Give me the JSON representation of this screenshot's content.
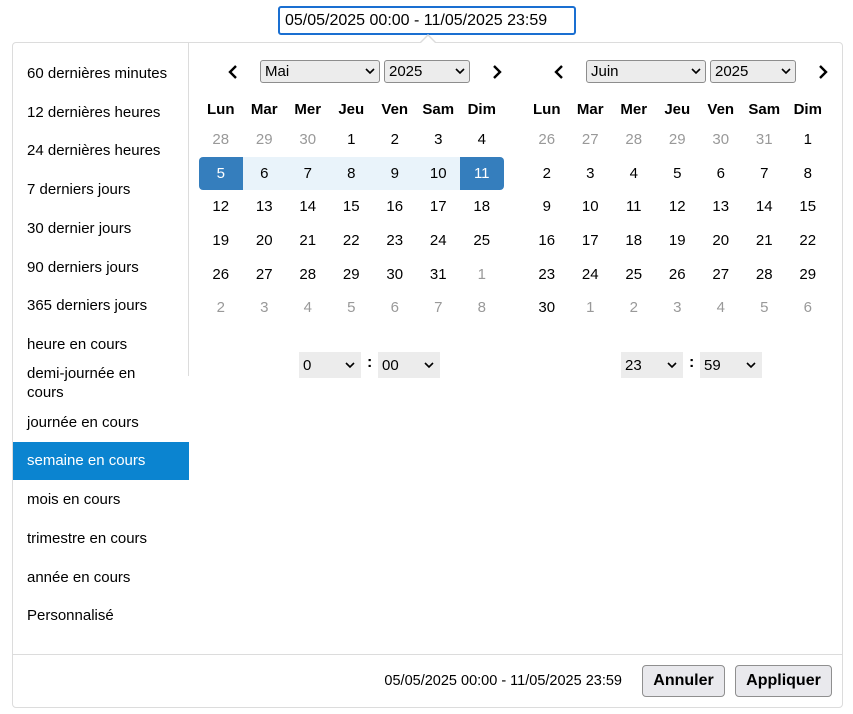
{
  "input": {
    "value": "05/05/2025 00:00 - 11/05/2025 23:59"
  },
  "ranges": [
    "60 dernières minutes",
    "12 dernières heures",
    "24 dernières heures",
    "7 derniers jours",
    "30 dernier jours",
    "90 derniers jours",
    "365 derniers jours",
    "heure en cours",
    "demi-journée en cours",
    "journée en cours",
    "semaine en cours",
    "mois en cours",
    "trimestre en cours",
    "année en cours",
    "Personnalisé"
  ],
  "active_range_index": 10,
  "weekdays": [
    "Lun",
    "Mar",
    "Mer",
    "Jeu",
    "Ven",
    "Sam",
    "Dim"
  ],
  "left_calendar": {
    "month": "Mai",
    "year": "2025",
    "weeks": [
      [
        {
          "d": "28",
          "s": "off"
        },
        {
          "d": "29",
          "s": "off"
        },
        {
          "d": "30",
          "s": "off"
        },
        {
          "d": "1",
          "s": ""
        },
        {
          "d": "2",
          "s": ""
        },
        {
          "d": "3",
          "s": ""
        },
        {
          "d": "4",
          "s": ""
        }
      ],
      [
        {
          "d": "5",
          "s": "start"
        },
        {
          "d": "6",
          "s": "inrange"
        },
        {
          "d": "7",
          "s": "inrange"
        },
        {
          "d": "8",
          "s": "inrange"
        },
        {
          "d": "9",
          "s": "inrange"
        },
        {
          "d": "10",
          "s": "inrange"
        },
        {
          "d": "11",
          "s": "end"
        }
      ],
      [
        {
          "d": "12",
          "s": ""
        },
        {
          "d": "13",
          "s": ""
        },
        {
          "d": "14",
          "s": ""
        },
        {
          "d": "15",
          "s": ""
        },
        {
          "d": "16",
          "s": ""
        },
        {
          "d": "17",
          "s": ""
        },
        {
          "d": "18",
          "s": ""
        }
      ],
      [
        {
          "d": "19",
          "s": ""
        },
        {
          "d": "20",
          "s": ""
        },
        {
          "d": "21",
          "s": ""
        },
        {
          "d": "22",
          "s": ""
        },
        {
          "d": "23",
          "s": ""
        },
        {
          "d": "24",
          "s": ""
        },
        {
          "d": "25",
          "s": ""
        }
      ],
      [
        {
          "d": "26",
          "s": ""
        },
        {
          "d": "27",
          "s": ""
        },
        {
          "d": "28",
          "s": ""
        },
        {
          "d": "29",
          "s": ""
        },
        {
          "d": "30",
          "s": ""
        },
        {
          "d": "31",
          "s": ""
        },
        {
          "d": "1",
          "s": "off"
        }
      ],
      [
        {
          "d": "2",
          "s": "off"
        },
        {
          "d": "3",
          "s": "off"
        },
        {
          "d": "4",
          "s": "off"
        },
        {
          "d": "5",
          "s": "off"
        },
        {
          "d": "6",
          "s": "off"
        },
        {
          "d": "7",
          "s": "off"
        },
        {
          "d": "8",
          "s": "off"
        }
      ]
    ],
    "hour": "0",
    "minute": "00"
  },
  "right_calendar": {
    "month": "Juin",
    "year": "2025",
    "weeks": [
      [
        {
          "d": "26",
          "s": "off"
        },
        {
          "d": "27",
          "s": "off"
        },
        {
          "d": "28",
          "s": "off"
        },
        {
          "d": "29",
          "s": "off"
        },
        {
          "d": "30",
          "s": "off"
        },
        {
          "d": "31",
          "s": "off"
        },
        {
          "d": "1",
          "s": ""
        }
      ],
      [
        {
          "d": "2",
          "s": ""
        },
        {
          "d": "3",
          "s": ""
        },
        {
          "d": "4",
          "s": ""
        },
        {
          "d": "5",
          "s": ""
        },
        {
          "d": "6",
          "s": ""
        },
        {
          "d": "7",
          "s": ""
        },
        {
          "d": "8",
          "s": ""
        }
      ],
      [
        {
          "d": "9",
          "s": ""
        },
        {
          "d": "10",
          "s": ""
        },
        {
          "d": "11",
          "s": ""
        },
        {
          "d": "12",
          "s": ""
        },
        {
          "d": "13",
          "s": ""
        },
        {
          "d": "14",
          "s": ""
        },
        {
          "d": "15",
          "s": ""
        }
      ],
      [
        {
          "d": "16",
          "s": ""
        },
        {
          "d": "17",
          "s": ""
        },
        {
          "d": "18",
          "s": ""
        },
        {
          "d": "19",
          "s": ""
        },
        {
          "d": "20",
          "s": ""
        },
        {
          "d": "21",
          "s": ""
        },
        {
          "d": "22",
          "s": ""
        }
      ],
      [
        {
          "d": "23",
          "s": ""
        },
        {
          "d": "24",
          "s": ""
        },
        {
          "d": "25",
          "s": ""
        },
        {
          "d": "26",
          "s": ""
        },
        {
          "d": "27",
          "s": ""
        },
        {
          "d": "28",
          "s": ""
        },
        {
          "d": "29",
          "s": ""
        }
      ],
      [
        {
          "d": "30",
          "s": ""
        },
        {
          "d": "1",
          "s": "off"
        },
        {
          "d": "2",
          "s": "off"
        },
        {
          "d": "3",
          "s": "off"
        },
        {
          "d": "4",
          "s": "off"
        },
        {
          "d": "5",
          "s": "off"
        },
        {
          "d": "6",
          "s": "off"
        }
      ]
    ],
    "hour": "23",
    "minute": "59"
  },
  "time_separator": ":",
  "footer": {
    "selected": "05/05/2025 00:00 - 11/05/2025 23:59",
    "cancel_label": "Annuler",
    "apply_label": "Appliquer"
  },
  "icons": {
    "prev": "chevron-left-icon",
    "next": "chevron-right-icon",
    "dropdown": "chevron-down-icon"
  },
  "colors": {
    "accent": "#0b84d0",
    "selected_day": "#357ebd",
    "in_range": "#e9f3fa",
    "input_border": "#1a6fd1"
  }
}
